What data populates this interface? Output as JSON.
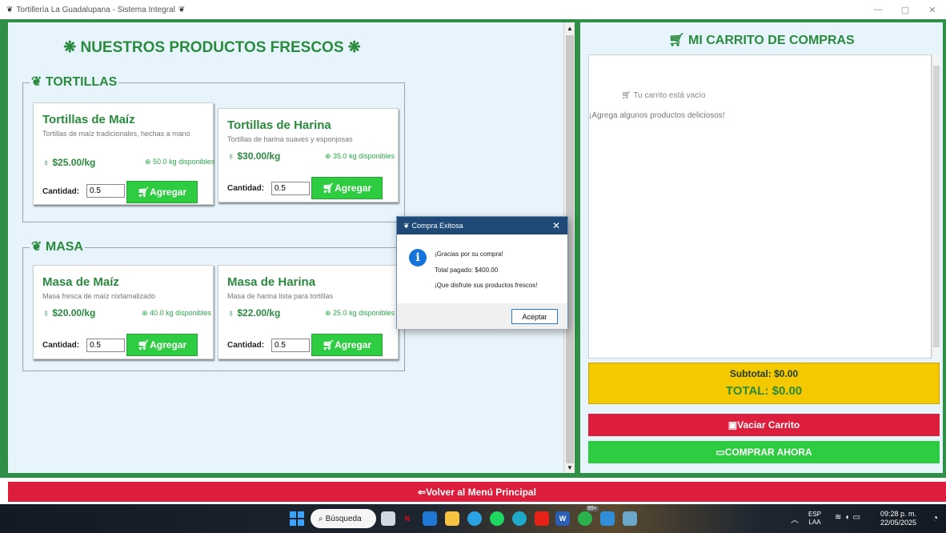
{
  "window": {
    "title": "Tortillería La Guadalupana - Sistema Integral",
    "title_icon": "leaf-icon",
    "controls": {
      "minimize": "—",
      "maximize": "▢",
      "close": "✕"
    }
  },
  "products": {
    "title": "❋ NUESTROS PRODUCTOS FRESCOS ❋",
    "sections": [
      {
        "label": "TORTILLAS",
        "items": [
          {
            "name": "Tortillas de Maíz",
            "description": "Tortillas de maíz tradicionales, hechas a mano",
            "price": "$25.00/kg",
            "stock": "50.0 kg disponibles",
            "qty_label": "Cantidad:",
            "qty_value": "0.5",
            "button": "Agregar"
          },
          {
            "name": "Tortillas de Harina",
            "description": "Tortillas de harina suaves y esponjosas",
            "price": "$30.00/kg",
            "stock": "35.0 kg disponibles",
            "qty_label": "Cantidad:",
            "qty_value": "0.5",
            "button": "Agregar"
          }
        ]
      },
      {
        "label": "MASA",
        "items": [
          {
            "name": "Masa de Maíz",
            "description": "Masa fresca de maíz nixtamalizado",
            "price": "$20.00/kg",
            "stock": "40.0 kg disponibles",
            "qty_label": "Cantidad:",
            "qty_value": "0.5",
            "button": "Agregar"
          },
          {
            "name": "Masa de Harina",
            "description": "Masa de harina lista para tortillas",
            "price": "$22.00/kg",
            "stock": "25.0 kg disponibles",
            "qty_label": "Cantidad:",
            "qty_value": "0.5",
            "button": "Agregar"
          }
        ]
      }
    ]
  },
  "cart": {
    "title": "MI CARRITO DE COMPRAS",
    "empty_text": "Tu carrito está vacío",
    "hint": "¡Agrega algunos productos deliciosos!",
    "subtotal": "Subtotal: $0.00",
    "total": "TOTAL: $0.00",
    "clear_button": "Vaciar Carrito",
    "buy_button": "COMPRAR AHORA"
  },
  "back_button": "Volver al Menú Principal",
  "dialog": {
    "title": "Compra Exitosa",
    "lines": [
      "¡Gracias por su compra!",
      "Total pagado: $400.00",
      "¡Que disfrute sus productos frescos!"
    ],
    "ok": "Aceptar"
  },
  "taskbar": {
    "search": "Búsqueda",
    "lang_1": "ESP",
    "lang_2": "LAA",
    "time": "09:28 p. m.",
    "date": "22/05/2025",
    "badge": "99+"
  },
  "colors": {
    "accent_green": "#2a8a3e",
    "button_green": "#2ecc40",
    "button_red": "#dc1e3c",
    "total_yellow": "#f4c900",
    "frame_green": "#2f8f46"
  }
}
